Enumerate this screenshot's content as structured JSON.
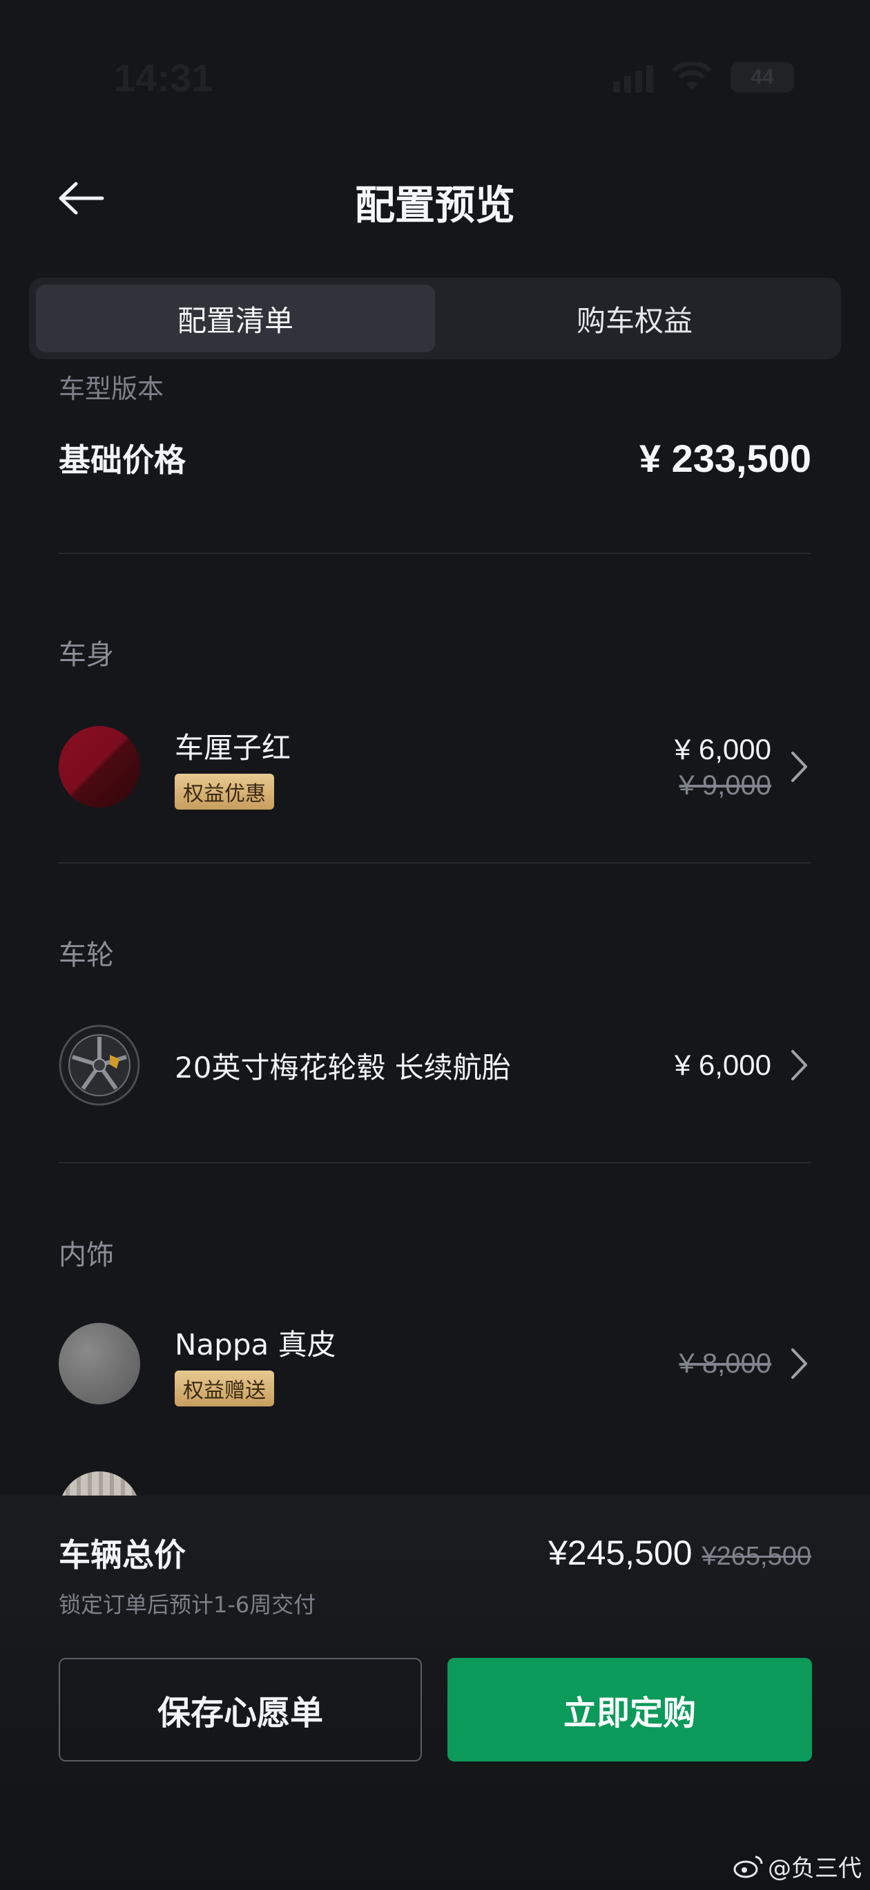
{
  "status_bar": {
    "time": "14:31",
    "battery": "44"
  },
  "header": {
    "title": "配置预览"
  },
  "tabs": [
    {
      "label": "配置清单",
      "active": true
    },
    {
      "label": "购车权益",
      "active": false
    }
  ],
  "content": {
    "clipped_label": "车型版本",
    "base": {
      "label": "基础价格",
      "price": "¥ 233,500"
    },
    "sections": [
      {
        "title": "车身",
        "item": {
          "name": "车厘子红",
          "badge": "权益优惠",
          "price": "¥ 6,000",
          "old_price": "¥ 9,000",
          "icon": "paint-swatch"
        }
      },
      {
        "title": "车轮",
        "item": {
          "name": "20英寸梅花轮毂 长续航胎",
          "price": "¥ 6,000",
          "icon": "wheel-swatch"
        }
      },
      {
        "title": "内饰",
        "item": {
          "name": "Nappa 真皮",
          "badge": "权益赠送",
          "old_price": "¥ 8,000",
          "icon": "leather-swatch"
        }
      }
    ]
  },
  "bottom": {
    "total_label": "车辆总价",
    "total_price": "¥245,500",
    "total_old_price": "¥265,500",
    "delivery_note": "锁定订单后预计1-6周交付",
    "wishlist_button": "保存心愿单",
    "order_button": "立即定购"
  },
  "watermark": "@负三代",
  "colors": {
    "background": "#14161a",
    "accent_green": "#0b9a5a",
    "badge_gold": "#d9b57a"
  }
}
